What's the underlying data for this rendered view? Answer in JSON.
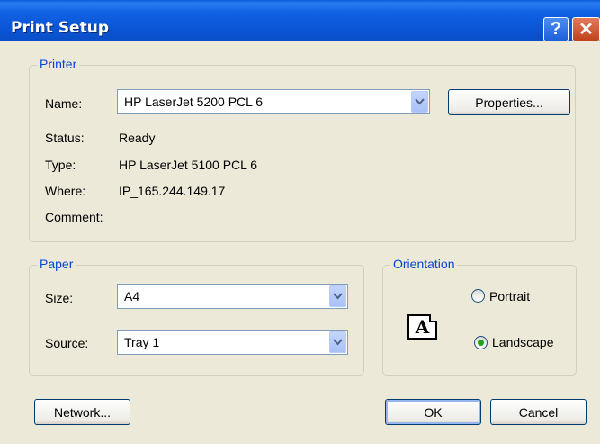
{
  "window": {
    "title": "Print Setup",
    "help_glyph": "?",
    "close_glyph": "✕"
  },
  "printer": {
    "group_label": "Printer",
    "name_label": "Name:",
    "name_value": "HP LaserJet 5200 PCL 6",
    "properties_button": "Properties...",
    "status_label": "Status:",
    "status_value": "Ready",
    "type_label": "Type:",
    "type_value": "HP LaserJet 5100 PCL 6",
    "where_label": "Where:",
    "where_value": "IP_165.244.149.17",
    "comment_label": "Comment:",
    "comment_value": ""
  },
  "paper": {
    "group_label": "Paper",
    "size_label": "Size:",
    "size_value": "A4",
    "source_label": "Source:",
    "source_value": "Tray 1"
  },
  "orientation": {
    "group_label": "Orientation",
    "icon_letter": "A",
    "portrait_label": "Portrait",
    "landscape_label": "Landscape",
    "selected": "Landscape"
  },
  "buttons": {
    "network": "Network...",
    "ok": "OK",
    "cancel": "Cancel"
  },
  "icons": {
    "dropdown": "chevron-down-icon",
    "help": "help-icon",
    "close": "close-icon"
  },
  "colors": {
    "title_bar": "#0a55d6",
    "group_label": "#0046d5",
    "dialog_bg": "#ece9d8",
    "radio_selected": "#21a121"
  }
}
